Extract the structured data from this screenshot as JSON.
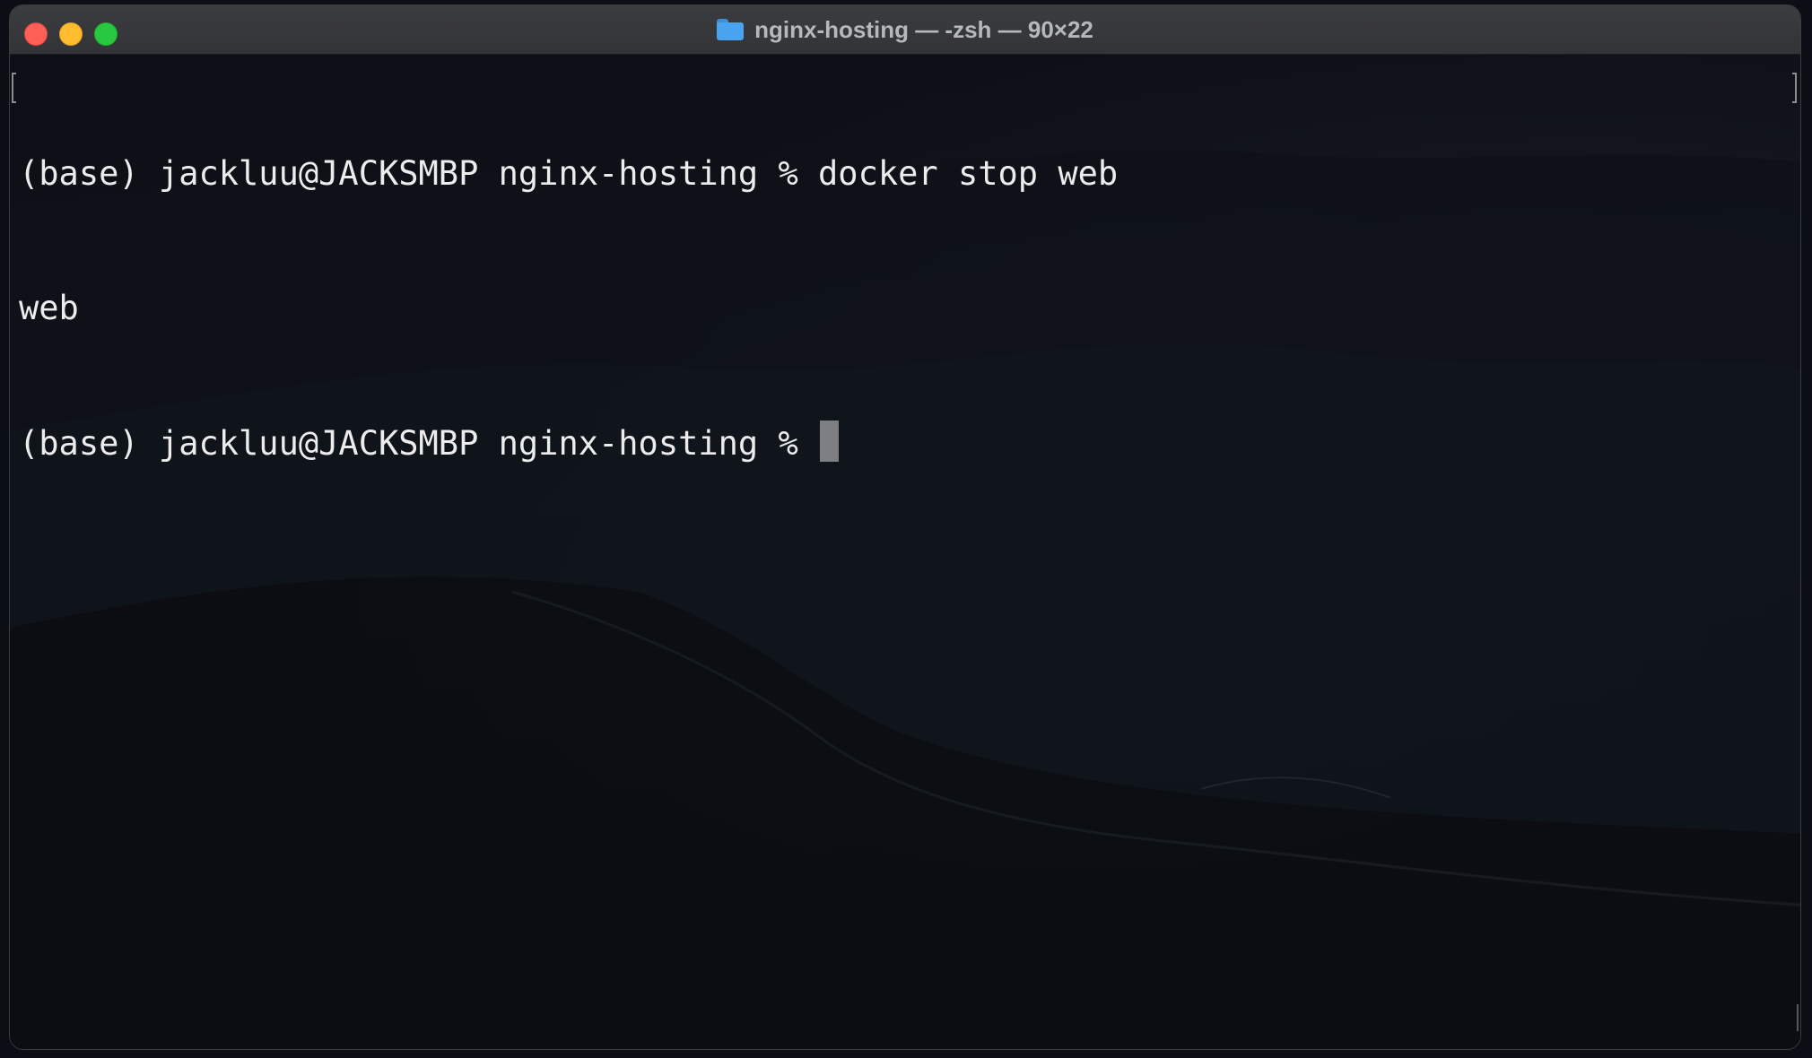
{
  "window": {
    "title": "nginx-hosting — -zsh — 90×22",
    "title_icon": "folder-icon",
    "traffic_lights": {
      "close_color": "#fe5f57",
      "minimize_color": "#febc2e",
      "zoom_color": "#28c840"
    }
  },
  "terminal": {
    "lines": [
      "(base) jackluu@JACKSMBP nginx-hosting % docker stop web",
      "web",
      "(base) jackluu@JACKSMBP nginx-hosting % "
    ],
    "cursor_icon": "block-cursor",
    "text_color": "#ececec",
    "background_color": "#0b0e14"
  }
}
